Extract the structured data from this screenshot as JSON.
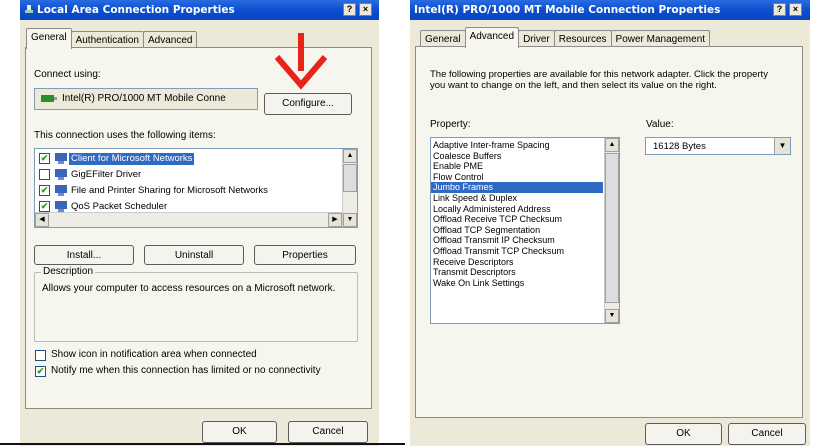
{
  "left": {
    "title": "Local Area Connection Properties",
    "help_btn": "?",
    "close_btn": "×",
    "tabs": [
      "General",
      "Authentication",
      "Advanced"
    ],
    "connect_using_label": "Connect using:",
    "adapter_name": "Intel(R) PRO/1000 MT Mobile Conne",
    "configure_label": "Configure...",
    "items_label": "This connection uses the following items:",
    "items": [
      {
        "label": "Client for Microsoft Networks",
        "checked": true,
        "selected": true
      },
      {
        "label": "GigEFilter Driver",
        "checked": false,
        "selected": false
      },
      {
        "label": "File and Printer Sharing for Microsoft Networks",
        "checked": true,
        "selected": false
      },
      {
        "label": "QoS Packet Scheduler",
        "checked": true,
        "selected": false
      }
    ],
    "install_label": "Install...",
    "uninstall_label": "Uninstall",
    "properties_label": "Properties",
    "description_title": "Description",
    "description_text": "Allows your computer to access resources on a Microsoft network.",
    "show_icon_label": "Show icon in notification area when connected",
    "show_icon_checked": false,
    "notify_label": "Notify me when this connection has limited or no connectivity",
    "notify_checked": true,
    "ok_label": "OK",
    "cancel_label": "Cancel"
  },
  "right": {
    "title": "Intel(R) PRO/1000 MT Mobile Connection Properties",
    "help_btn": "?",
    "close_btn": "×",
    "tabs": [
      "General",
      "Advanced",
      "Driver",
      "Resources",
      "Power Management"
    ],
    "intro_text": "The following properties are available for this network adapter. Click the property you want to change on the left, and then select its value on the right.",
    "property_label": "Property:",
    "value_label": "Value:",
    "properties": [
      "Adaptive Inter-frame Spacing",
      "Coalesce Buffers",
      "Enable PME",
      "Flow Control",
      "Jumbo Frames",
      "Link Speed & Duplex",
      "Locally Administered Address",
      "Offload Receive TCP Checksum",
      "Offload TCP Segmentation",
      "Offload Transmit IP Checksum",
      "Offload Transmit TCP Checksum",
      "Receive Descriptors",
      "Transmit Descriptors",
      "Wake On Link Settings"
    ],
    "selected_property": "Jumbo Frames",
    "value_selected": "16128 Bytes",
    "ok_label": "OK",
    "cancel_label": "Cancel"
  },
  "annotation": {
    "arrow_color": "#e8231a"
  },
  "colors": {
    "titlebar": "#0a4fd0",
    "dialog_bg": "#ece9d8",
    "selection": "#316ac5"
  }
}
